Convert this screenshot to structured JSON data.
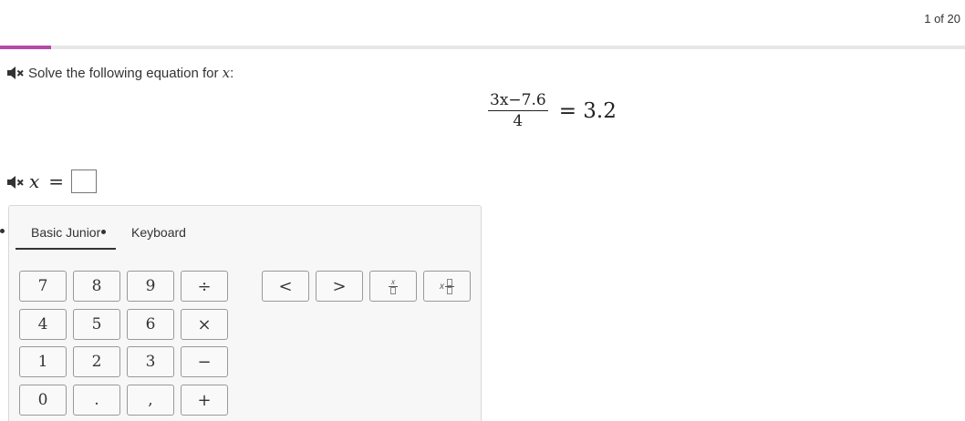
{
  "header": {
    "counter": "1 of 20",
    "progress_fraction": 0.053
  },
  "question": {
    "prompt": "Solve the following equation for",
    "variable": "x",
    "colon": ":",
    "numerator": "3x−7.6",
    "denominator": "4",
    "rhs": "= 3.2"
  },
  "answer": {
    "variable": "x",
    "equals": "="
  },
  "keypad": {
    "tabs": [
      {
        "label": "Basic Junior"
      },
      {
        "label": "Keyboard"
      }
    ],
    "keys": {
      "k7": "7",
      "k8": "8",
      "k9": "9",
      "div": "÷",
      "k4": "4",
      "k5": "5",
      "k6": "6",
      "mul": "×",
      "k1": "1",
      "k2": "2",
      "k3": "3",
      "minus": "−",
      "k0": "0",
      "dot": ".",
      "comma": ",",
      "plus": "+",
      "lt": "<",
      "gt": ">",
      "frac_x": "x",
      "mixed_x": "x"
    }
  },
  "icons": {
    "mute": "speaker-muted-icon"
  },
  "colors": {
    "accent": "#b54aa8"
  }
}
